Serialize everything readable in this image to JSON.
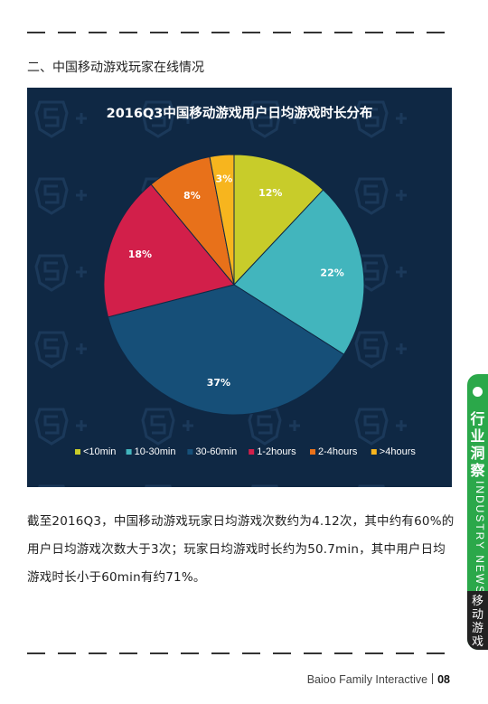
{
  "header": {
    "section_title": "二、中国移动游戏玩家在线情况"
  },
  "chart_data": {
    "type": "pie",
    "title": "2016Q3中国移动游戏用户日均游戏时长分布",
    "categories": [
      "<10min",
      "10-30min",
      "30-60min",
      "1-2hours",
      "2-4hours",
      ">4hours"
    ],
    "values": [
      12,
      22,
      37,
      18,
      8,
      3
    ],
    "value_labels": [
      "12%",
      "22%",
      "37%",
      "18%",
      "8%",
      "3%"
    ],
    "colors": [
      "#c8cc2a",
      "#42b5bd",
      "#164f78",
      "#d21f4a",
      "#e8711a",
      "#f7b51e"
    ],
    "legend_position": "bottom",
    "start_angle": "12 o'clock, clockwise"
  },
  "body": {
    "paragraph": "截至2016Q3，中国移动游戏玩家日均游戏次数约为4.12次，其中约有60%的用户日均游戏次数大于3次；玩家日均游戏时长约为50.7min，其中用户日均游戏时长小于60min有约71%。"
  },
  "side_tab": {
    "category": "行业洞察",
    "english": "INDUSTRY NEWS",
    "topic": "移动游戏"
  },
  "footer": {
    "company": "Baioo Family Interactive",
    "page_number": "08"
  }
}
